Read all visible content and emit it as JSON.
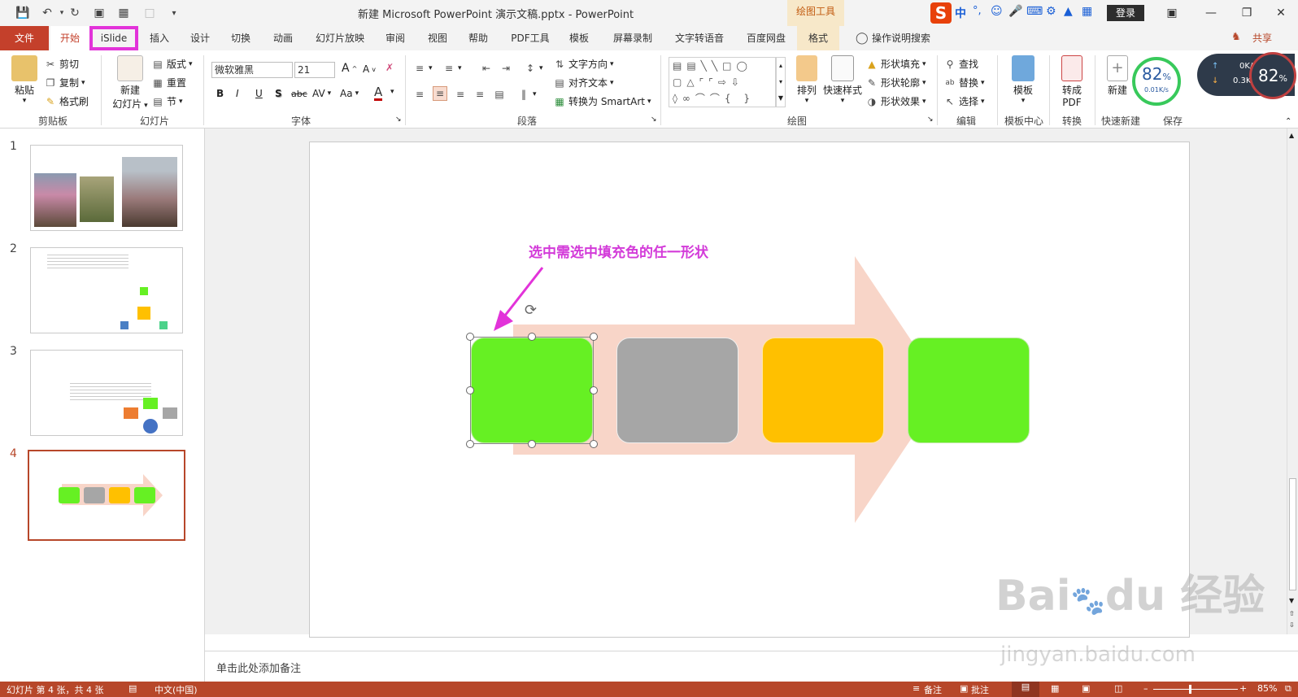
{
  "window": {
    "title": "新建 Microsoft PowerPoint 演示文稿.pptx  -  PowerPoint",
    "contextual_tab_group": "绘图工具",
    "login": "登录",
    "share": "共享"
  },
  "tabs": [
    {
      "label": "文件"
    },
    {
      "label": "开始"
    },
    {
      "label": "iSlide"
    },
    {
      "label": "插入"
    },
    {
      "label": "设计"
    },
    {
      "label": "切换"
    },
    {
      "label": "动画"
    },
    {
      "label": "幻灯片放映"
    },
    {
      "label": "审阅"
    },
    {
      "label": "视图"
    },
    {
      "label": "帮助"
    },
    {
      "label": "PDF工具"
    },
    {
      "label": "模板"
    },
    {
      "label": "屏幕录制"
    },
    {
      "label": "文字转语音"
    },
    {
      "label": "百度网盘"
    },
    {
      "label": "格式"
    }
  ],
  "tell_me": "操作说明搜索",
  "ribbon": {
    "clipboard": {
      "label": "剪贴板",
      "paste": "粘贴",
      "cut": "剪切",
      "copy": "复制",
      "format_painter": "格式刷"
    },
    "slides": {
      "label": "幻灯片",
      "new_slide": "新建",
      "new_slide2": "幻灯片",
      "layout": "版式",
      "reset": "重置",
      "section": "节"
    },
    "font": {
      "label": "字体",
      "font_name": "微软雅黑",
      "font_size": "21",
      "bold": "B",
      "italic": "I",
      "underline": "U",
      "shadow": "S",
      "strike": "abc",
      "spacing": "AV",
      "case": "Aa",
      "color": "A",
      "grow": "A",
      "shrink": "A"
    },
    "paragraph": {
      "label": "段落",
      "text_direction": "文字方向",
      "align_text": "对齐文本",
      "smartart": "转换为 SmartArt"
    },
    "drawing": {
      "label": "绘图",
      "arrange": "排列",
      "quick_styles": "快速样式",
      "shape_fill": "形状填充",
      "shape_outline": "形状轮廓",
      "shape_effects": "形状效果"
    },
    "editing": {
      "label": "编辑",
      "find": "查找",
      "replace": "替换",
      "select": "选择"
    },
    "template_center": {
      "label": "模板中心",
      "templates": "模板"
    },
    "convert": {
      "label": "转换",
      "to_pdf1": "转成",
      "to_pdf2": "PDF"
    },
    "quick_new": {
      "label": "快速新建",
      "new": "新建"
    },
    "save": {
      "label": "保存"
    }
  },
  "speed_widget": {
    "percent": "82",
    "pct_sign": "%",
    "rate": "0.01K/s",
    "up": "0K/s",
    "down": "0.3K/s",
    "percent2": "82",
    "pct_sign2": "%"
  },
  "thumbnails": [
    {
      "num": "1"
    },
    {
      "num": "2"
    },
    {
      "num": "3"
    },
    {
      "num": "4"
    }
  ],
  "slide": {
    "annotation": "选中需选中填充色的任一形状",
    "colors": {
      "green": "#66f023",
      "gray": "#a6a6a6",
      "yellow": "#ffc000",
      "arrow": "#f8d5c8"
    }
  },
  "notes_placeholder": "单击此处添加备注",
  "status": {
    "slide_info": "幻灯片 第 4 张，共 4 张",
    "language": "中文(中国)",
    "notes": "备注",
    "comments": "批注",
    "zoom": "85%"
  },
  "watermark": {
    "brand": "Bai",
    "brand2": "du",
    "cn": "经验",
    "url": "jingyan.baidu.com"
  }
}
